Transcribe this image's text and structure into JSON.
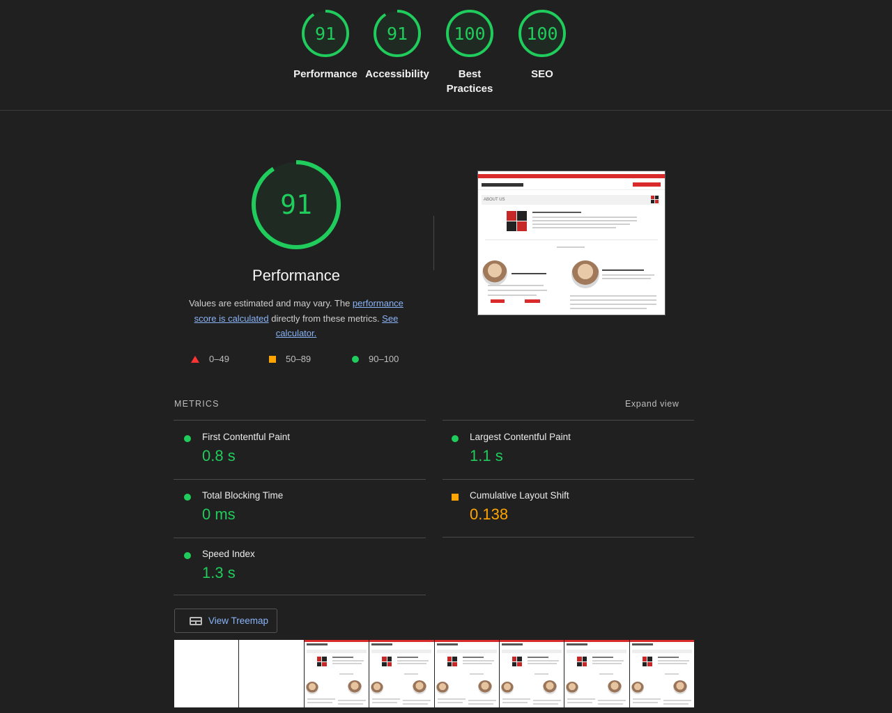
{
  "colors": {
    "pass": "#20cc5c",
    "average": "#ffa400",
    "fail": "#ff3333",
    "link": "#8ab4f8"
  },
  "gauges": [
    {
      "score": "91",
      "label": "Performance",
      "fraction": 0.91
    },
    {
      "score": "91",
      "label": "Accessibility",
      "fraction": 0.91
    },
    {
      "score": "100",
      "label": "Best Practices",
      "fraction": 1.0
    },
    {
      "score": "100",
      "label": "SEO",
      "fraction": 1.0
    }
  ],
  "performance": {
    "score": "91",
    "fraction": 0.91,
    "title": "Performance",
    "desc_prefix": "Values are estimated and may vary. The ",
    "desc_link1": "performance score is calculated",
    "desc_mid": " directly from these metrics. ",
    "desc_link2": "See calculator."
  },
  "legend": {
    "fail": "0–49",
    "average": "50–89",
    "pass": "90–100"
  },
  "screenshot": {
    "section_title": "ABOUT US"
  },
  "metrics": {
    "heading": "METRICS",
    "expand_label": "Expand view",
    "items": [
      {
        "name": "First Contentful Paint",
        "value": "0.8 s",
        "status": "pass"
      },
      {
        "name": "Largest Contentful Paint",
        "value": "1.1 s",
        "status": "pass"
      },
      {
        "name": "Total Blocking Time",
        "value": "0 ms",
        "status": "pass"
      },
      {
        "name": "Cumulative Layout Shift",
        "value": "0.138",
        "status": "average"
      },
      {
        "name": "Speed Index",
        "value": "1.3 s",
        "status": "pass"
      }
    ]
  },
  "treemap_label": "View Treemap"
}
